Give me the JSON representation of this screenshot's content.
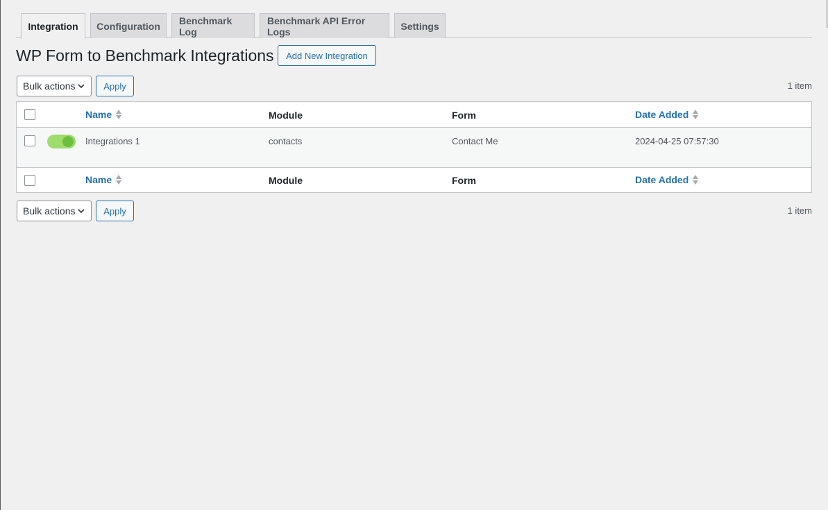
{
  "tabs": [
    {
      "label": "Integration",
      "active": true
    },
    {
      "label": "Configuration",
      "active": false
    },
    {
      "label": "Benchmark Log",
      "active": false
    },
    {
      "label": "Benchmark API Error Logs",
      "active": false
    },
    {
      "label": "Settings",
      "active": false
    }
  ],
  "page": {
    "title": "WP Form to Benchmark Integrations",
    "add_new_label": "Add New Integration"
  },
  "tablenav": {
    "bulk_actions_label": "Bulk actions",
    "apply_label": "Apply",
    "item_count": "1 item"
  },
  "table": {
    "columns": {
      "name": "Name",
      "module": "Module",
      "form": "Form",
      "date_added": "Date Added"
    },
    "rows": [
      {
        "enabled": true,
        "name": "Integrations 1",
        "module": "contacts",
        "form": "Contact Me",
        "date_added": "2024-04-25 07:57:30"
      }
    ]
  },
  "colors": {
    "accent": "#2271b1",
    "toggle_on_track": "#9fdc6c",
    "toggle_on_knob": "#6cbf3e",
    "background": "#f0f0f1"
  }
}
